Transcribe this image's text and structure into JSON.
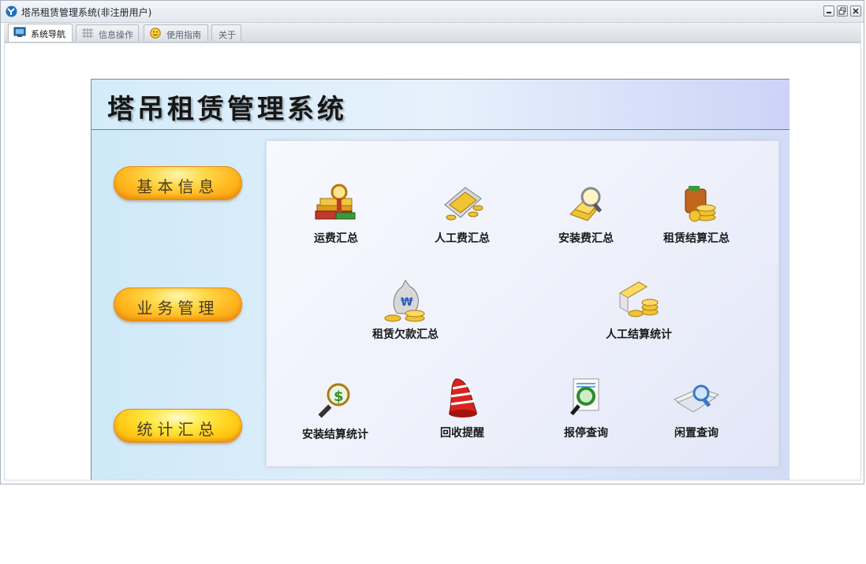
{
  "window": {
    "title": "塔吊租赁管理系统(非注册用户)",
    "controls": [
      "minimize-icon",
      "restore-icon",
      "close-icon"
    ]
  },
  "tabs": [
    {
      "label": "系统导航",
      "icon": "monitor-icon",
      "active": true
    },
    {
      "label": "信息操作",
      "icon": "grid-icon",
      "active": false
    },
    {
      "label": "使用指南",
      "icon": "smiley-icon",
      "active": false
    },
    {
      "label": "关于",
      "icon": "",
      "active": false
    }
  ],
  "banner": {
    "title": "塔吊租赁管理系统"
  },
  "sidebar": {
    "buttons": [
      {
        "label": "基本信息"
      },
      {
        "label": "业务管理"
      },
      {
        "label": "统计汇总"
      }
    ]
  },
  "functions": {
    "items": [
      {
        "label": "运费汇总",
        "icon": "books-magnifier-icon"
      },
      {
        "label": "人工费汇总",
        "icon": "coin-tray-icon"
      },
      {
        "label": "安装费汇总",
        "icon": "gold-magnifier-icon"
      },
      {
        "label": "租赁结算汇总",
        "icon": "wallet-coins-icon"
      },
      {
        "label": "租赁欠款汇总",
        "icon": "money-bag-icon"
      },
      {
        "label": "人工结算统计",
        "icon": "gold-bars-icon"
      },
      {
        "label": "安装结算统计",
        "icon": "dollar-magnifier-icon"
      },
      {
        "label": "回收提醒",
        "icon": "alarm-bell-icon"
      },
      {
        "label": "报停查询",
        "icon": "document-magnifier-icon"
      },
      {
        "label": "闲置查询",
        "icon": "papers-magnifier-icon"
      }
    ]
  },
  "colors": {
    "button_orange": "#ffb61d",
    "button_yellow": "#ffcc16",
    "panel_blue": "#dfeefb",
    "title_text": "#161616"
  }
}
